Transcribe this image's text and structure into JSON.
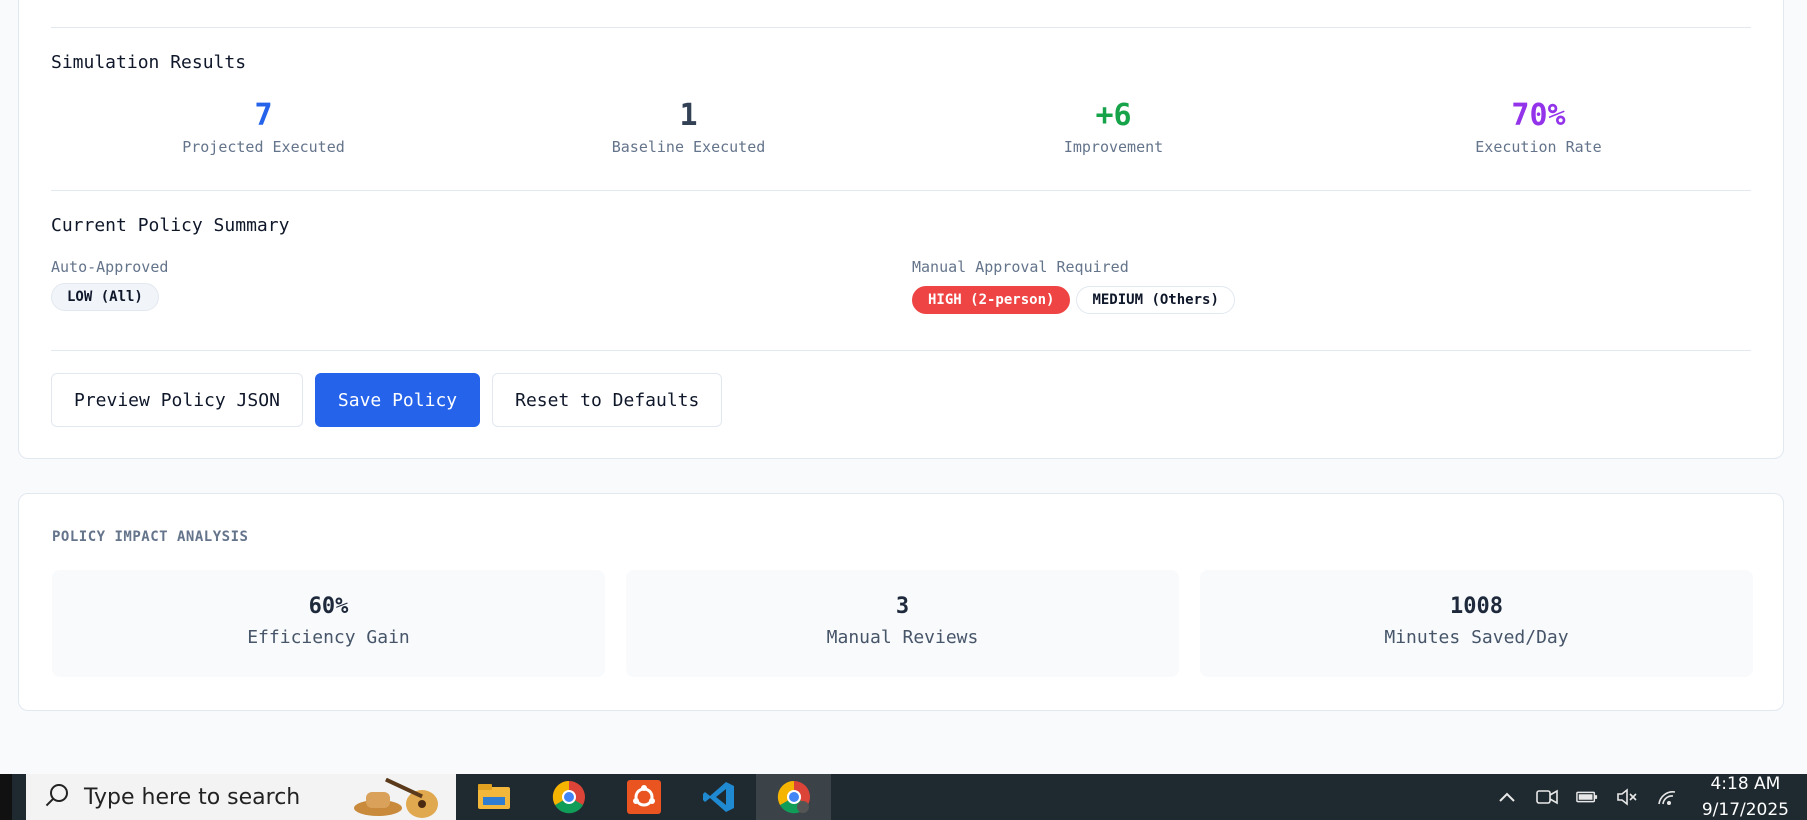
{
  "simulation": {
    "title": "Simulation Results",
    "stats": [
      {
        "value": "7",
        "label": "Projected Executed",
        "color": "#2563eb"
      },
      {
        "value": "1",
        "label": "Baseline Executed",
        "color": "#334155"
      },
      {
        "value": "+6",
        "label": "Improvement",
        "color": "#16a34a"
      },
      {
        "value": "70%",
        "label": "Execution Rate",
        "color": "#9333ea"
      }
    ]
  },
  "policy_summary": {
    "title": "Current Policy Summary",
    "auto_label": "Auto-Approved",
    "auto_pills": [
      "LOW (All)"
    ],
    "manual_label": "Manual Approval Required",
    "manual_pills": [
      "HIGH (2-person)",
      "MEDIUM (Others)"
    ]
  },
  "actions": {
    "preview_label": "Preview Policy JSON",
    "save_label": "Save Policy",
    "reset_label": "Reset to Defaults"
  },
  "impact": {
    "title": "POLICY IMPACT ANALYSIS",
    "items": [
      {
        "value": "60%",
        "label": "Efficiency Gain"
      },
      {
        "value": "3",
        "label": "Manual Reviews"
      },
      {
        "value": "1008",
        "label": "Minutes Saved/Day"
      }
    ]
  },
  "taskbar": {
    "search_placeholder": "Type here to search",
    "apps": [
      "file-explorer-icon",
      "chrome-icon",
      "ubuntu-icon",
      "vscode-icon",
      "chrome-profile-icon"
    ],
    "time": "4:18 AM",
    "date": "9/17/2025"
  },
  "colors": {
    "primary": "#2563eb",
    "danger": "#ef4444",
    "success": "#16a34a",
    "purple": "#9333ea"
  }
}
